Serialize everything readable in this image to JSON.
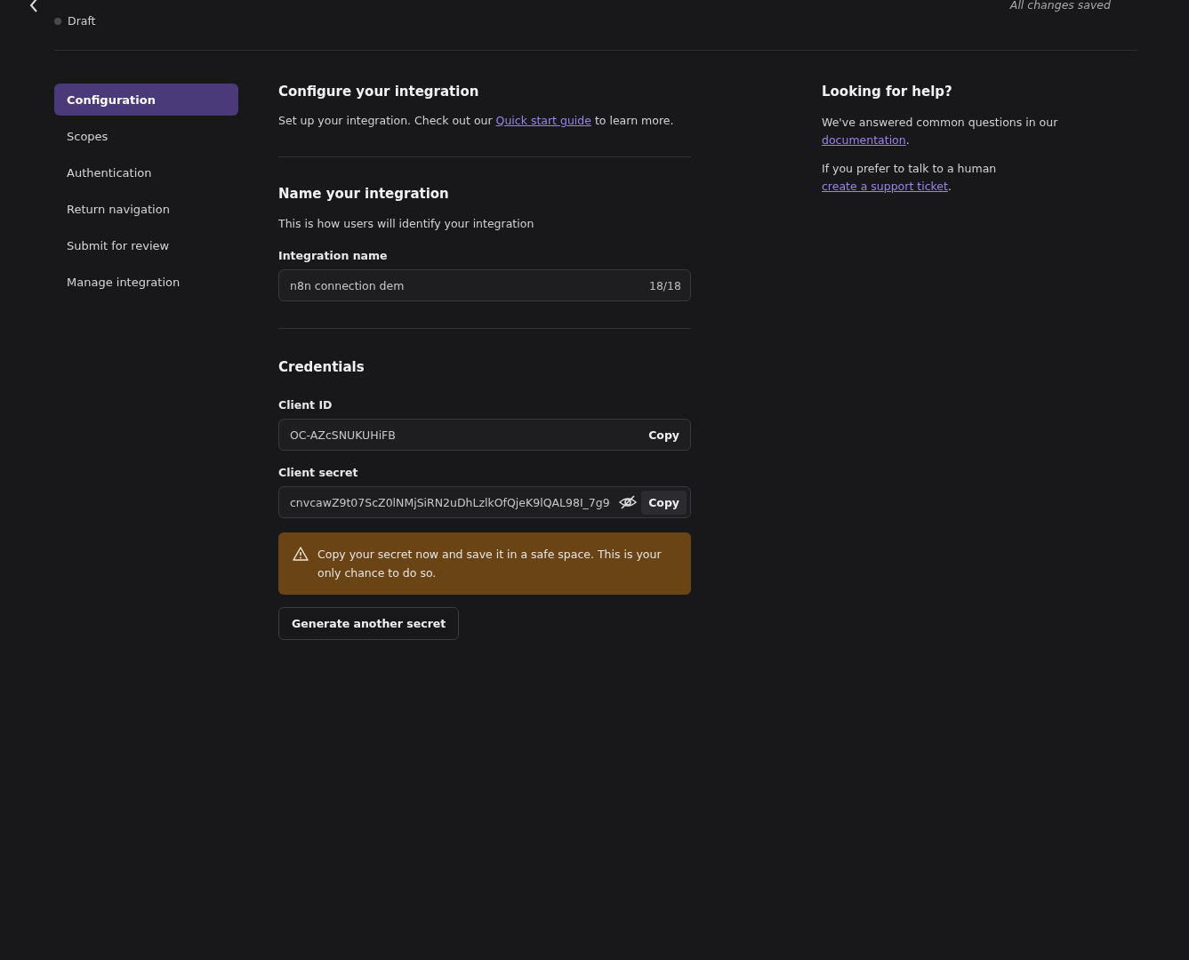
{
  "header": {
    "status": "Draft",
    "save_state": "All changes saved"
  },
  "sidebar": {
    "items": [
      {
        "label": "Configuration",
        "selected": true
      },
      {
        "label": "Scopes",
        "selected": false
      },
      {
        "label": "Authentication",
        "selected": false
      },
      {
        "label": "Return navigation",
        "selected": false
      },
      {
        "label": "Submit for review",
        "selected": false
      },
      {
        "label": "Manage integration",
        "selected": false
      }
    ]
  },
  "configure": {
    "title": "Configure your integration",
    "text_before": "Set up your integration. Check out our ",
    "link": "Quick start guide",
    "text_after": " to learn more."
  },
  "name_section": {
    "title": "Name your integration",
    "description": "This is how users will identify your integration",
    "field_label": "Integration name",
    "value": "n8n connection dem",
    "counter": "18/18"
  },
  "credentials": {
    "title": "Credentials",
    "client_id_label": "Client ID",
    "client_id": "OC-AZcSNUKUHiFB",
    "client_id_button": "Copy",
    "secret_label": "Client secret",
    "secret": "cnvcawZ9t07ScZ0lNMjSiRN2uDhLzlkOfQjeK9lQAL98I_7g9",
    "secret_button": "Copy",
    "warning": "Copy your secret now and save it in a safe space. This is your only chance to do so.",
    "generate_button": "Generate another secret"
  },
  "help": {
    "title": "Looking for help?",
    "docs_before": "We've answered common questions in our ",
    "docs_link": "documentation",
    "docs_after": ".",
    "support_before": "If you prefer to talk to a human ",
    "support_link": "create a support ticket",
    "support_after": "."
  }
}
